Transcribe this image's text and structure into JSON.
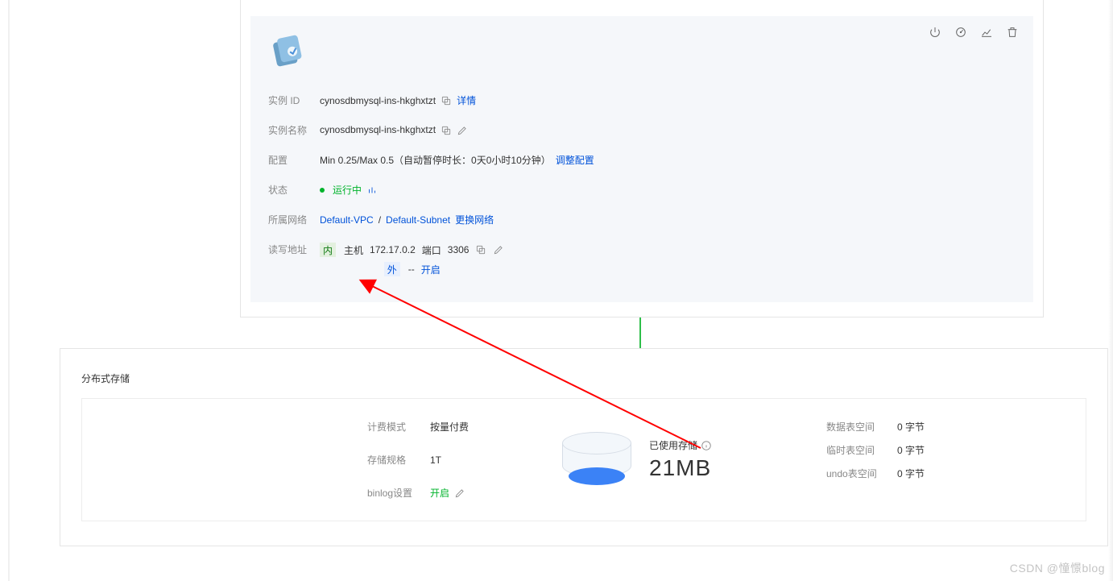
{
  "instance": {
    "head_fragment": "",
    "id_label": "实例 ID",
    "id_value": "cynosdbmysql-ins-hkghxtzt",
    "detail_link": "详情",
    "name_label": "实例名称",
    "name_value": "cynosdbmysql-ins-hkghxtzt",
    "config_label": "配置",
    "config_value": "Min 0.25/Max 0.5（自动暂停时长：0天0小时10分钟）",
    "config_link": "调整配置",
    "status_label": "状态",
    "status_value": "运行中",
    "network_label": "所属网络",
    "network_vpc": "Default-VPC",
    "network_sep": " /",
    "network_subnet": "Default-Subnet",
    "network_change": "更换网络",
    "addr_label": "读写地址",
    "addr_internal_badge": "内",
    "addr_host_label": "主机",
    "addr_host_value": "172.17.0.2",
    "addr_port_label": "端口",
    "addr_port_value": "3306",
    "addr_external_badge": "外",
    "addr_external_placeholder": "--",
    "addr_external_enable": "开启"
  },
  "storage": {
    "title": "分布式存储",
    "billing_mode_label": "计费模式",
    "billing_mode_value": "按量付费",
    "spec_label": "存储规格",
    "spec_value": "1T",
    "binlog_label": "binlog设置",
    "binlog_value": "开启",
    "used_label": "已使用存储",
    "used_value": "21MB",
    "rows": [
      {
        "k": "数据表空间",
        "v": "0 字节"
      },
      {
        "k": "临时表空间",
        "v": "0 字节"
      },
      {
        "k": "undo表空间",
        "v": "0 字节"
      }
    ]
  },
  "watermark": "CSDN @憧憬blog"
}
